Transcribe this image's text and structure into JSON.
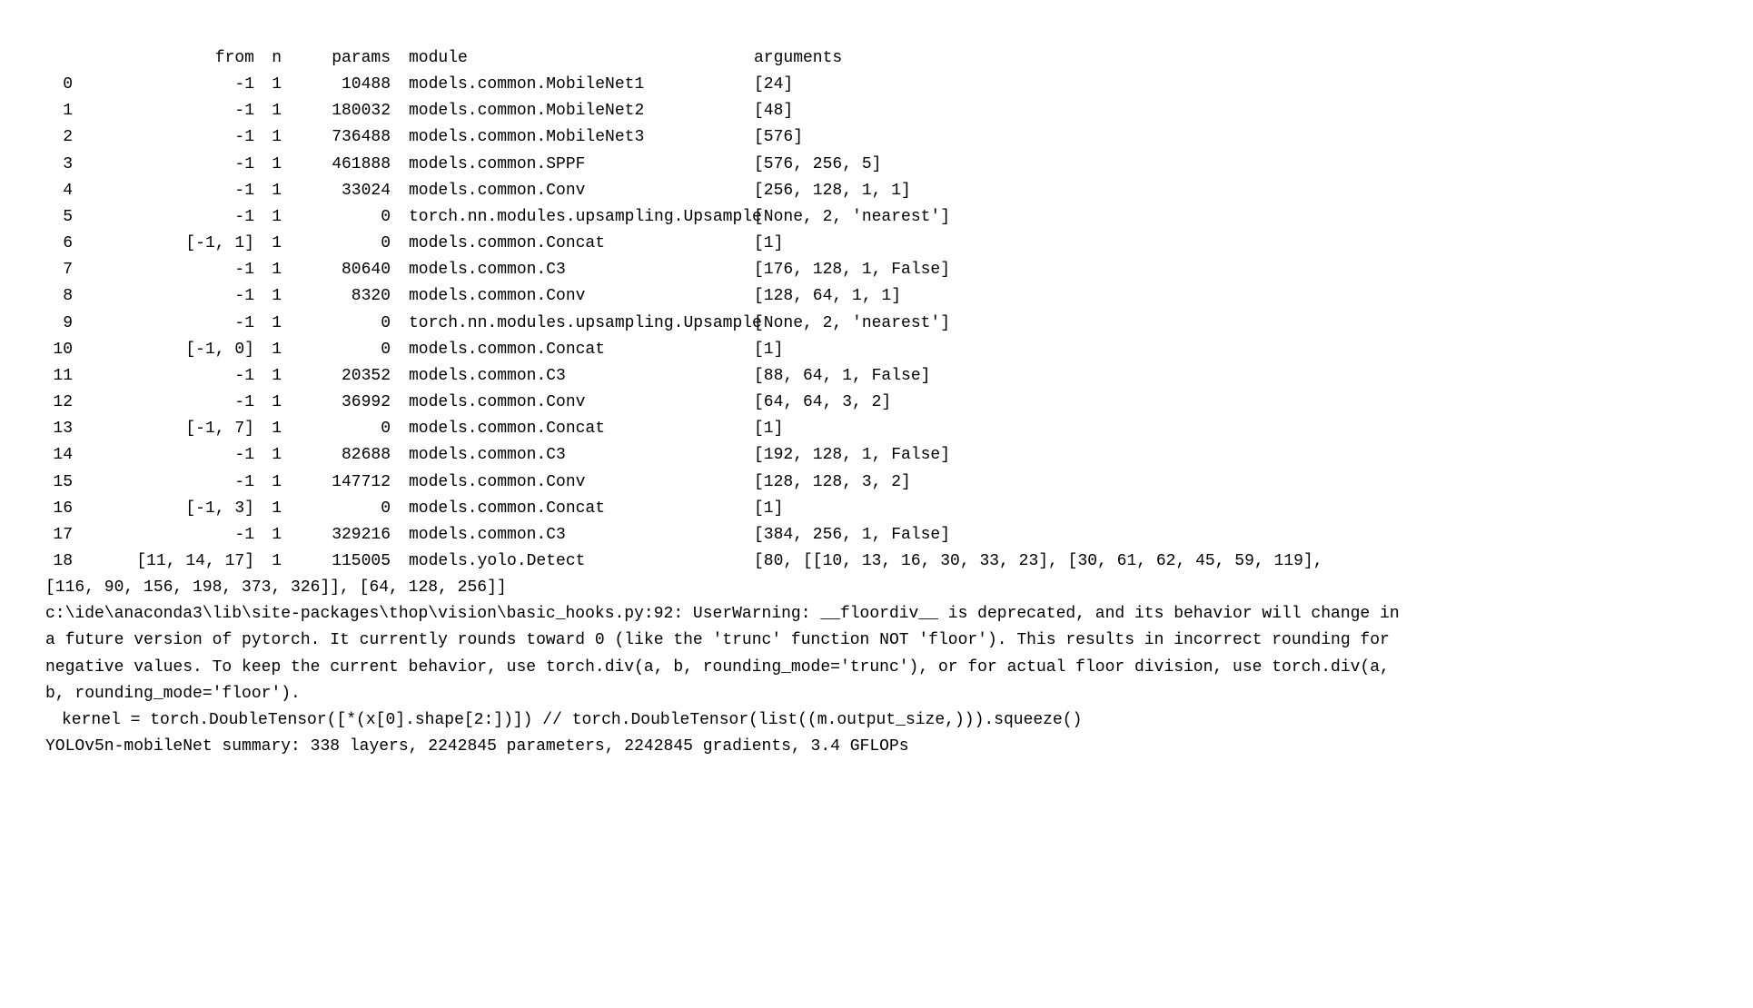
{
  "headers": {
    "from": "from",
    "n": "n",
    "params": "params",
    "module": "module",
    "arguments": "arguments"
  },
  "rows": [
    {
      "idx": "0",
      "from": "-1",
      "n": "1",
      "params": "10488",
      "module": "models.common.MobileNet1",
      "args": "[24]"
    },
    {
      "idx": "1",
      "from": "-1",
      "n": "1",
      "params": "180032",
      "module": "models.common.MobileNet2",
      "args": "[48]"
    },
    {
      "idx": "2",
      "from": "-1",
      "n": "1",
      "params": "736488",
      "module": "models.common.MobileNet3",
      "args": "[576]"
    },
    {
      "idx": "3",
      "from": "-1",
      "n": "1",
      "params": "461888",
      "module": "models.common.SPPF",
      "args": "[576, 256, 5]"
    },
    {
      "idx": "4",
      "from": "-1",
      "n": "1",
      "params": "33024",
      "module": "models.common.Conv",
      "args": "[256, 128, 1, 1]"
    },
    {
      "idx": "5",
      "from": "-1",
      "n": "1",
      "params": "0",
      "module": "torch.nn.modules.upsampling.Upsample",
      "args": "[None, 2, 'nearest']"
    },
    {
      "idx": "6",
      "from": "[-1, 1]",
      "n": "1",
      "params": "0",
      "module": "models.common.Concat",
      "args": "[1]"
    },
    {
      "idx": "7",
      "from": "-1",
      "n": "1",
      "params": "80640",
      "module": "models.common.C3",
      "args": "[176, 128, 1, False]"
    },
    {
      "idx": "8",
      "from": "-1",
      "n": "1",
      "params": "8320",
      "module": "models.common.Conv",
      "args": "[128, 64, 1, 1]"
    },
    {
      "idx": "9",
      "from": "-1",
      "n": "1",
      "params": "0",
      "module": "torch.nn.modules.upsampling.Upsample",
      "args": "[None, 2, 'nearest']"
    },
    {
      "idx": "10",
      "from": "[-1, 0]",
      "n": "1",
      "params": "0",
      "module": "models.common.Concat",
      "args": "[1]"
    },
    {
      "idx": "11",
      "from": "-1",
      "n": "1",
      "params": "20352",
      "module": "models.common.C3",
      "args": "[88, 64, 1, False]"
    },
    {
      "idx": "12",
      "from": "-1",
      "n": "1",
      "params": "36992",
      "module": "models.common.Conv",
      "args": "[64, 64, 3, 2]"
    },
    {
      "idx": "13",
      "from": "[-1, 7]",
      "n": "1",
      "params": "0",
      "module": "models.common.Concat",
      "args": "[1]"
    },
    {
      "idx": "14",
      "from": "-1",
      "n": "1",
      "params": "82688",
      "module": "models.common.C3",
      "args": "[192, 128, 1, False]"
    },
    {
      "idx": "15",
      "from": "-1",
      "n": "1",
      "params": "147712",
      "module": "models.common.Conv",
      "args": "[128, 128, 3, 2]"
    },
    {
      "idx": "16",
      "from": "[-1, 3]",
      "n": "1",
      "params": "0",
      "module": "models.common.Concat",
      "args": "[1]"
    },
    {
      "idx": "17",
      "from": "-1",
      "n": "1",
      "params": "329216",
      "module": "models.common.C3",
      "args": "[384, 256, 1, False]"
    },
    {
      "idx": "18",
      "from": "[11, 14, 17]",
      "n": "1",
      "params": "115005",
      "module": "models.yolo.Detect",
      "args": "[80, [[10, 13, 16, 30, 33, 23], [30, 61, 62, 45, 59, 119],"
    }
  ],
  "continuation_line": "[116, 90, 156, 198, 373, 326]], [64, 128, 256]]",
  "warning_lines": [
    "c:\\ide\\anaconda3\\lib\\site-packages\\thop\\vision\\basic_hooks.py:92: UserWarning: __floordiv__ is deprecated, and its behavior will change in",
    "a future version of pytorch. It currently rounds toward 0 (like the 'trunc' function NOT 'floor'). This results in incorrect rounding for",
    "negative values. To keep the current behavior, use torch.div(a, b, rounding_mode='trunc'), or for actual floor division, use torch.div(a,",
    "b, rounding_mode='floor')."
  ],
  "kernel_line": "kernel = torch.DoubleTensor([*(x[0].shape[2:])]) // torch.DoubleTensor(list((m.output_size,))).squeeze()",
  "summary_line": "YOLOv5n-mobileNet summary: 338 layers, 2242845 parameters, 2242845 gradients, 3.4 GFLOPs"
}
